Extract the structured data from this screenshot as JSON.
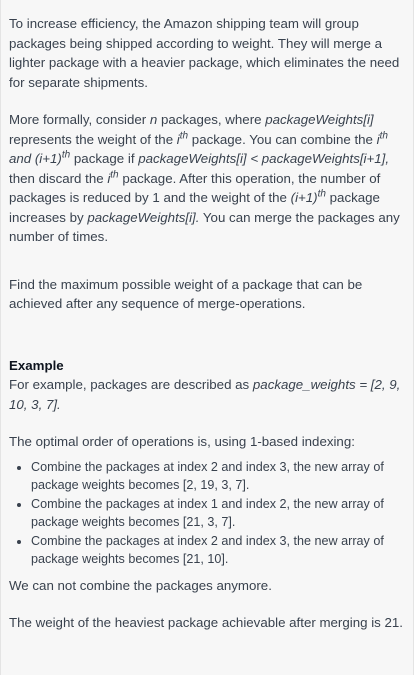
{
  "intro": "To increase efficiency, the Amazon shipping team will group packages being shipped according to weight.  They will merge a lighter package with a heavier package, which eliminates the need for separate shipments.",
  "formal": {
    "t1": "More formally, consider ",
    "n": "n",
    "t2": " packages, where ",
    "pw_i": "packageWeights[i]",
    "t3": " represents the weight of the ",
    "i1": "i",
    "th1": "th",
    "t4": " package. You can combine the ",
    "i2": "i",
    "th2": "th",
    "and": "and (i+1)",
    "th3": "th",
    "t5": " package if ",
    "cond": "packageWeights[i] < packageWeights[i+1],",
    "t6": " then discard the ",
    "i3": "i",
    "th4": "th",
    "t7": " package. After this operation, the number of packages is reduced by 1 and the weight of the ",
    "ip1": "(i+1)",
    "th5": "th",
    "t8": " package increases by ",
    "pw_i2": "packageWeights[i].",
    "t9": " You can merge the packages any number of times."
  },
  "task": "Find the maximum possible weight of a package that can be achieved after any sequence of merge-operations.",
  "example": {
    "heading": "Example",
    "t1": "For example, packages are described as ",
    "arr": "package_weights = [2, 9, 10, 3, 7].",
    "optimal": "The optimal order of operations is, using 1-based indexing:",
    "steps": [
      "Combine the packages at index 2 and index 3, the new array of package weights becomes [2, 19, 3, 7].",
      "Combine the packages at index 1 and index 2, the new array of package weights becomes [21, 3, 7].",
      "Combine the packages at index 2 and index 3, the new array of package weights becomes [21, 10]."
    ],
    "cannot": "We can not combine the packages anymore.",
    "result": "The weight of the heaviest package achievable after merging is 21."
  }
}
